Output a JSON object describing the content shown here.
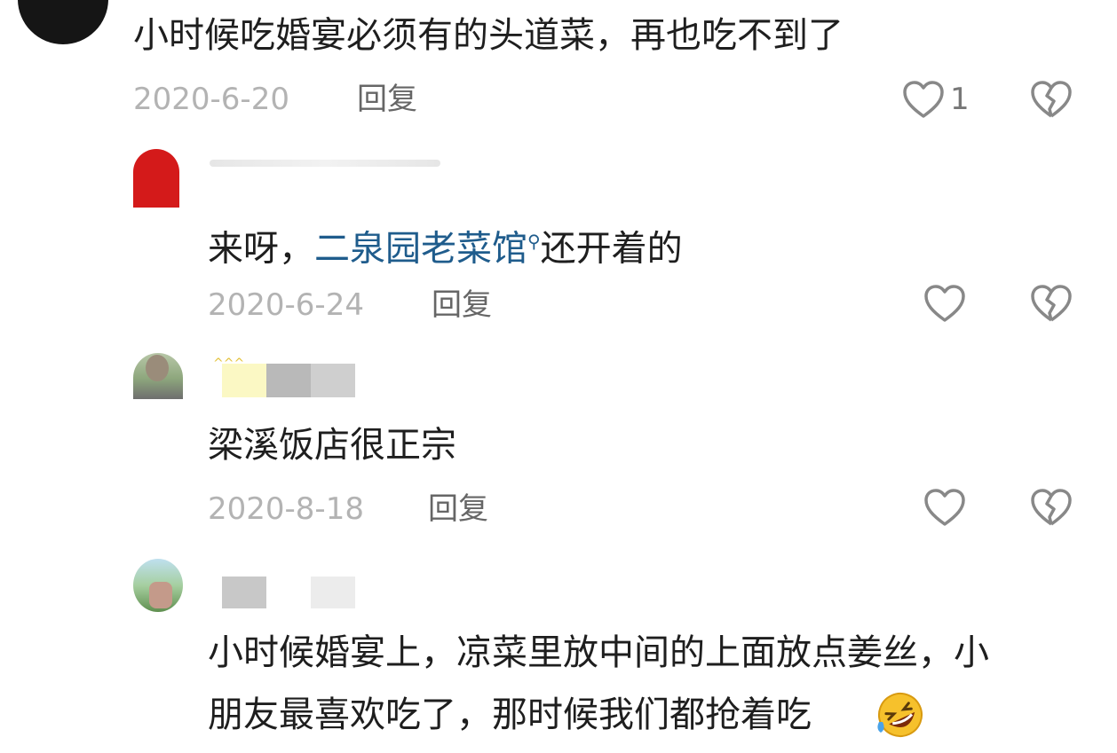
{
  "comments": [
    {
      "text": "小时候吃婚宴必须有的头道菜，再也吃不到了",
      "date": "2020-6-20",
      "reply_label": "回复",
      "like_count": "1"
    },
    {
      "text_prefix": "来呀，",
      "link_text": "二泉园老菜馆",
      "search_glyph": "⚲",
      "text_suffix": "还开着的",
      "date": "2020-6-24",
      "reply_label": "回复"
    },
    {
      "text": "梁溪饭店很正宗",
      "date": "2020-8-18",
      "reply_label": "回复"
    },
    {
      "text_line1": "小时候婚宴上，凉菜里放中间的上面放点姜丝，小",
      "text_line2": "朋友最喜欢吃了，那时候我们都抢着吃"
    }
  ],
  "icons": {
    "like": "heart-outline-icon",
    "dislike": "broken-heart-icon",
    "emoji": "rofl-emoji-icon",
    "search": "search-icon"
  },
  "colors": {
    "link": "#1f5c8c",
    "date": "#b3b3b3",
    "reply": "#666666",
    "icon": "#888888"
  }
}
